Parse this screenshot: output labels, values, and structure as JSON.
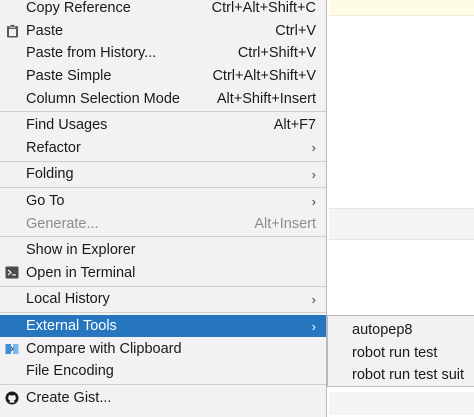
{
  "menu": {
    "items": [
      {
        "label": "Copy Reference",
        "shortcut": "Ctrl+Alt+Shift+C"
      },
      {
        "label": "Paste",
        "shortcut": "Ctrl+V",
        "icon": "clipboard-icon"
      },
      {
        "label": "Paste from History...",
        "shortcut": "Ctrl+Shift+V"
      },
      {
        "label": "Paste Simple",
        "shortcut": "Ctrl+Alt+Shift+V"
      },
      {
        "label": "Column Selection Mode",
        "shortcut": "Alt+Shift+Insert"
      },
      {
        "label": "Find Usages",
        "shortcut": "Alt+F7"
      },
      {
        "label": "Refactor",
        "submenu": true
      },
      {
        "label": "Folding",
        "submenu": true
      },
      {
        "label": "Go To",
        "submenu": true
      },
      {
        "label": "Generate...",
        "shortcut": "Alt+Insert",
        "disabled": true
      },
      {
        "label": "Show in Explorer"
      },
      {
        "label": "Open in Terminal",
        "icon": "terminal-icon"
      },
      {
        "label": "Local History",
        "submenu": true
      },
      {
        "label": "External Tools",
        "submenu": true,
        "selected": true
      },
      {
        "label": "Compare with Clipboard",
        "icon": "compare-icon"
      },
      {
        "label": "File Encoding"
      },
      {
        "label": "Create Gist...",
        "icon": "github-icon"
      }
    ],
    "arrow_glyph": "›"
  },
  "submenu": {
    "items": [
      {
        "label": "autopep8"
      },
      {
        "label": "robot run test"
      },
      {
        "label": "robot run test suit"
      }
    ]
  },
  "colors": {
    "menu_bg": "#f2f2f2",
    "selected_bg": "#2675bf",
    "disabled_text": "#8c8c8c"
  }
}
